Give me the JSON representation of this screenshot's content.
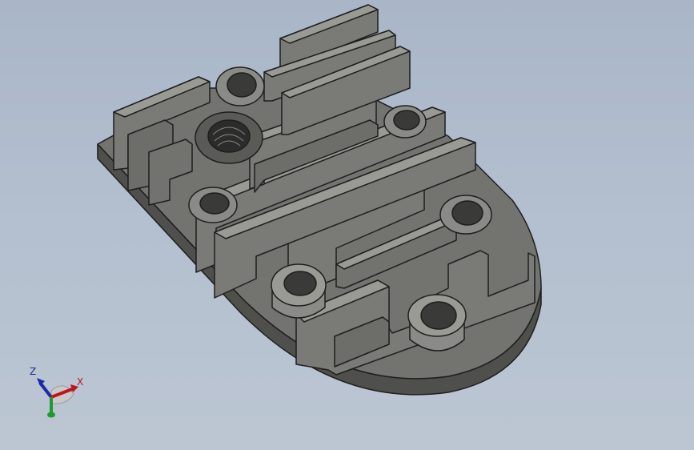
{
  "triad": {
    "z_label": "Z",
    "x_label": "X",
    "colors": {
      "x": "#c0141b",
      "y": "#1f9a2e",
      "z": "#1c2aa8"
    }
  },
  "model": {
    "icon": "heatsink-cover-3d-model",
    "colors": {
      "body": "#6e6e6a",
      "body_dark": "#4a4a47",
      "fin_face": "#7a7a76",
      "fin_top": "#9a9a95",
      "edge": "#1e1e1e"
    }
  }
}
